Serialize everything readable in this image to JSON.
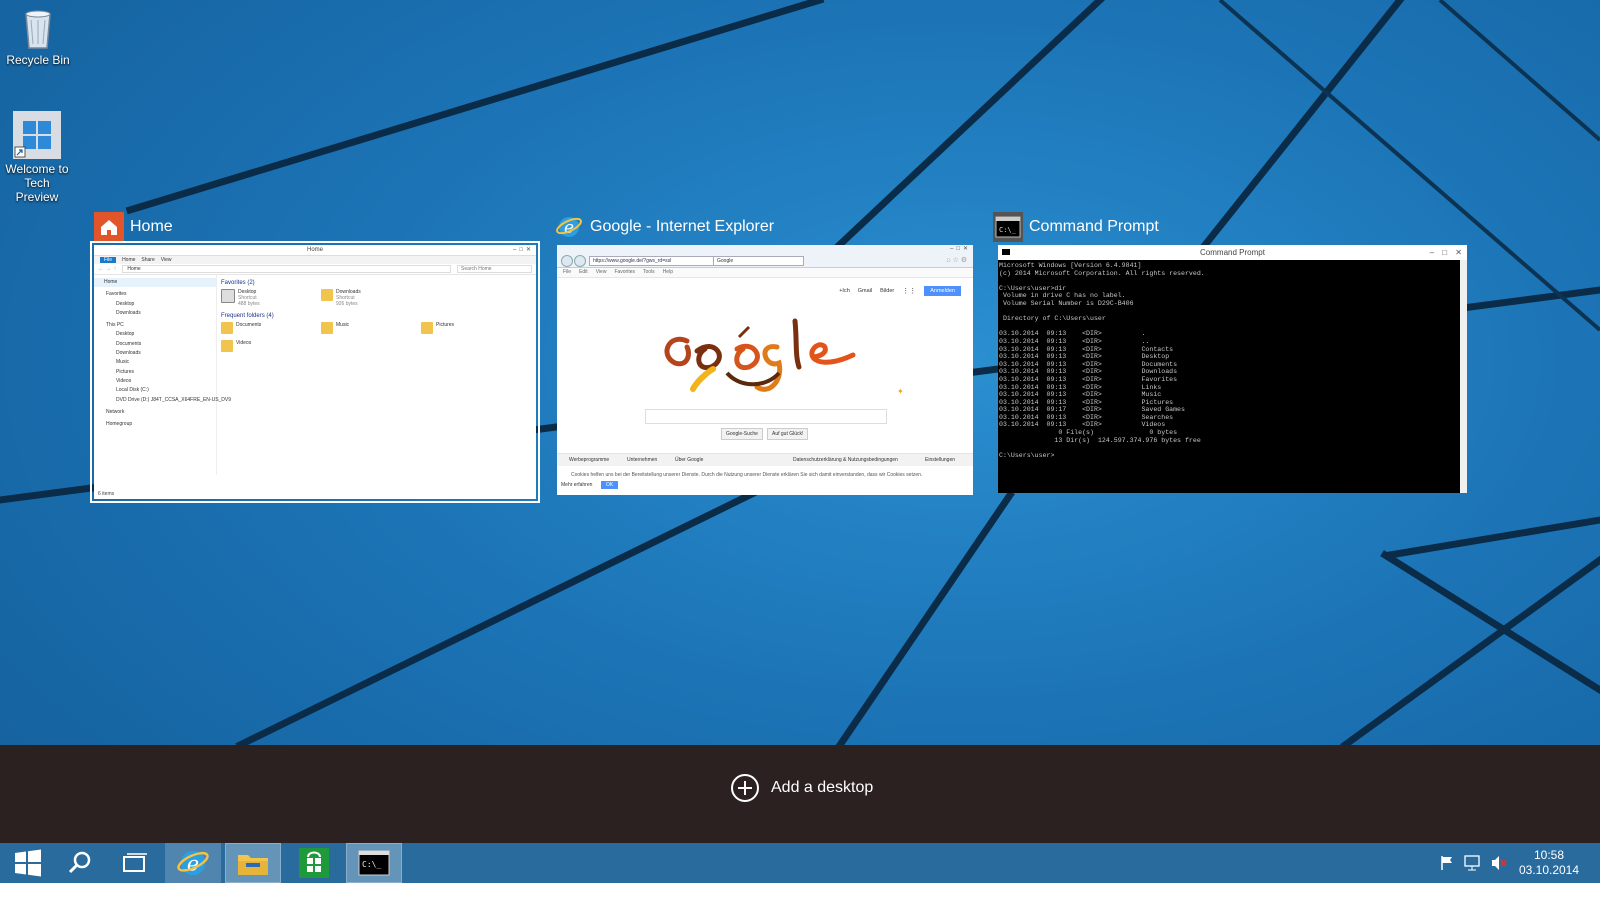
{
  "desktop": {
    "icons": [
      {
        "label_line1": "Recycle Bin",
        "label_line2": ""
      },
      {
        "label_line1": "Welcome to",
        "label_line2": "Tech Preview"
      }
    ]
  },
  "task_view": {
    "windows": [
      {
        "title": "Home",
        "selected": true
      },
      {
        "title": "Google - Internet Explorer",
        "selected": false
      },
      {
        "title": "Command Prompt",
        "selected": false
      }
    ],
    "explorer": {
      "window_title": "Home",
      "ribbon_tabs": [
        "File",
        "Home",
        "Share",
        "View"
      ],
      "address": "Home",
      "search_placeholder": "Search Home",
      "nav_items": [
        "Home",
        "Favorites",
        "Desktop",
        "Downloads",
        "This PC",
        "Desktop",
        "Documents",
        "Downloads",
        "Music",
        "Pictures",
        "Videos",
        "Local Disk (C:)",
        "DVD Drive (D:) J84T_CCSA_X64FRE_EN-US_DV9",
        "Network",
        "Homegroup"
      ],
      "favorites_heading": "Favorites (2)",
      "frequent_heading": "Frequent folders (4)",
      "favorites": [
        {
          "name": "Desktop",
          "sub1": "Shortcut",
          "sub2": "488 bytes"
        },
        {
          "name": "Downloads",
          "sub1": "Shortcut",
          "sub2": "926 bytes"
        }
      ],
      "frequent": [
        "Documents",
        "Music",
        "Pictures",
        "Videos"
      ],
      "status": "6 items"
    },
    "ie": {
      "url": "https://www.google.de/?gws_rd=ssl",
      "tab": "Google",
      "menu": [
        "File",
        "Edit",
        "View",
        "Favorites",
        "Tools",
        "Help"
      ],
      "top_links": [
        "+Ich",
        "Gmail",
        "Bilder"
      ],
      "signin": "Anmelden",
      "buttons": [
        "Google-Suche",
        "Auf gut Glück!"
      ],
      "footer_left": [
        "Werbeprogramme",
        "Unternehmen",
        "Über Google"
      ],
      "footer_right": [
        "Datenschutzerklärung & Nutzungsbedingungen",
        "Einstellungen"
      ],
      "cookie_text": "Cookies helfen uns bei der Bereitstellung unserer Dienste. Durch die Nutzung unserer Dienste erklären Sie sich damit einverstanden, dass wir Cookies setzen.",
      "more_info": "Mehr erfahren",
      "ok": "OK"
    },
    "cmd": {
      "window_title": "Command Prompt",
      "output": "Microsoft Windows [Version 6.4.9841]\n(c) 2014 Microsoft Corporation. All rights reserved.\n\nC:\\Users\\user>dir\n Volume in drive C has no label.\n Volume Serial Number is D29C-B406\n\n Directory of C:\\Users\\user\n\n03.10.2014  09:13    <DIR>          .\n03.10.2014  09:13    <DIR>          ..\n03.10.2014  09:13    <DIR>          Contacts\n03.10.2014  09:13    <DIR>          Desktop\n03.10.2014  09:13    <DIR>          Documents\n03.10.2014  09:13    <DIR>          Downloads\n03.10.2014  09:13    <DIR>          Favorites\n03.10.2014  09:13    <DIR>          Links\n03.10.2014  09:13    <DIR>          Music\n03.10.2014  09:13    <DIR>          Pictures\n03.10.2014  09:17    <DIR>          Saved Games\n03.10.2014  09:13    <DIR>          Searches\n03.10.2014  09:13    <DIR>          Videos\n               0 File(s)              0 bytes\n              13 Dir(s)  124.597.374.976 bytes free\n\nC:\\Users\\user>"
    },
    "add_desktop_label": "Add a desktop"
  },
  "taskbar": {
    "buttons": [
      "start-icon",
      "search-icon",
      "task-view-icon",
      "internet-explorer-icon",
      "file-explorer-icon",
      "store-icon",
      "command-prompt-icon"
    ],
    "clock_time": "10:58",
    "clock_date": "03.10.2014"
  },
  "colors": {
    "taskbar": "#2a6b9e",
    "add_desktop_bar": "#2a2120",
    "accent": "#1979ca"
  }
}
